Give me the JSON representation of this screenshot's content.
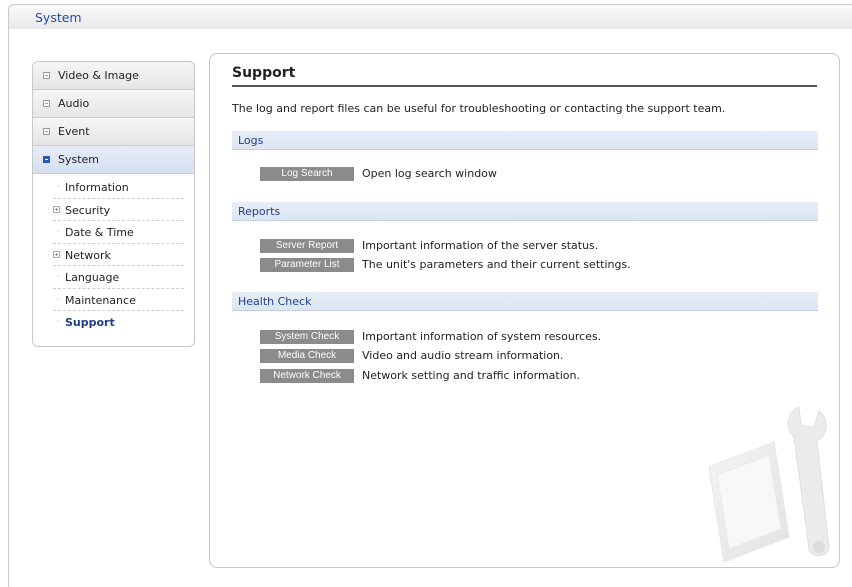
{
  "header": {
    "title": "System"
  },
  "sidebar": {
    "categories": [
      {
        "label": "Video & Image"
      },
      {
        "label": "Audio"
      },
      {
        "label": "Event"
      },
      {
        "label": "System"
      }
    ],
    "system_items": [
      {
        "label": "Information"
      },
      {
        "label": "Security"
      },
      {
        "label": "Date & Time"
      },
      {
        "label": "Network"
      },
      {
        "label": "Language"
      },
      {
        "label": "Maintenance"
      },
      {
        "label": "Support"
      }
    ]
  },
  "main": {
    "title": "Support",
    "intro": "The log and report files can be useful for troubleshooting or contacting the support team.",
    "sections": [
      {
        "title": "Logs",
        "items": [
          {
            "button": "Log Search",
            "desc": "Open log search window"
          }
        ]
      },
      {
        "title": "Reports",
        "items": [
          {
            "button": "Server Report",
            "desc": "Important information of the server status."
          },
          {
            "button": "Parameter List",
            "desc": "The unit's parameters and their current settings."
          }
        ]
      },
      {
        "title": "Health Check",
        "items": [
          {
            "button": "System Check",
            "desc": "Important information of system resources."
          },
          {
            "button": "Media Check",
            "desc": "Video and audio stream information."
          },
          {
            "button": "Network Check",
            "desc": "Network setting and traffic information."
          }
        ]
      }
    ]
  },
  "colors": {
    "accent": "#1f4aa6",
    "button_bg": "#8b8b8b",
    "section_bg": "#dce5f3"
  },
  "icons": {
    "collapsed": "square-icon",
    "expanded": "minus-square-icon",
    "tree_plus": "plus-box-icon",
    "bullet": "dot-icon"
  }
}
